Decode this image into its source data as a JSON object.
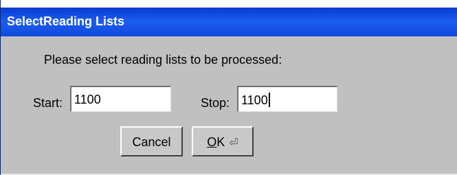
{
  "window": {
    "title": "SelectReading Lists"
  },
  "dialog": {
    "prompt": "Please select reading lists to be processed:",
    "start": {
      "label": "Start:",
      "value": "1100"
    },
    "stop": {
      "label": "Stop:",
      "value": "1100"
    },
    "buttons": {
      "cancel": "Cancel",
      "ok_mnemonic": "O",
      "ok_rest": "K",
      "ok_icon": "enter-icon"
    }
  },
  "colors": {
    "titlebar": "#1c5ef0",
    "dialog_bg": "#c0c0c0"
  }
}
